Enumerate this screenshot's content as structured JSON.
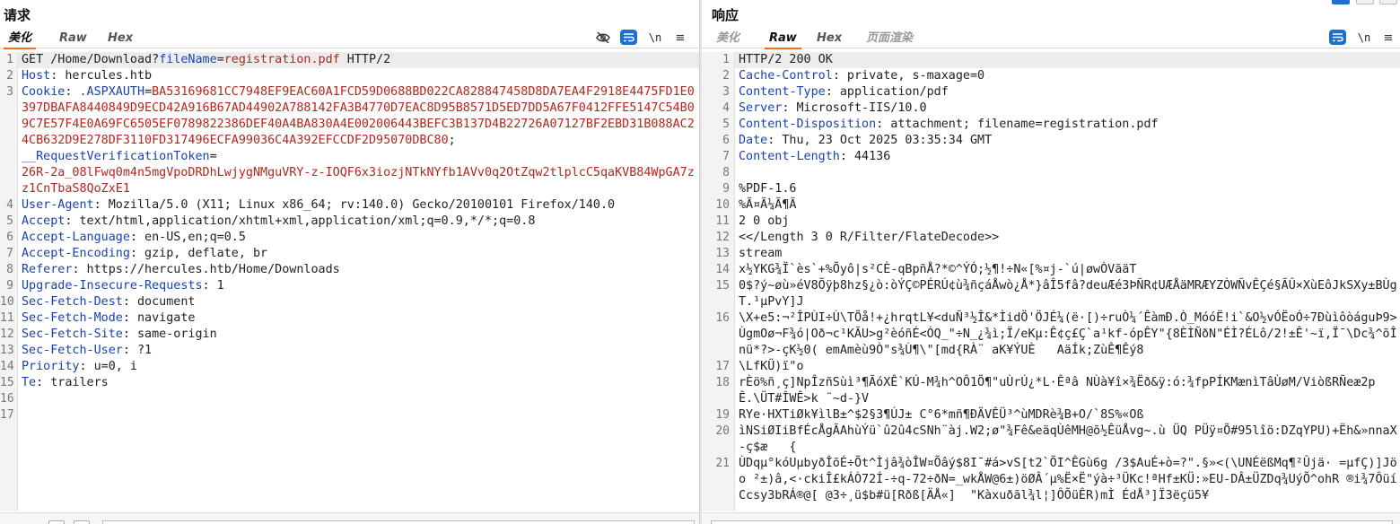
{
  "request": {
    "title": "请求",
    "tabs": [
      "美化",
      "Raw",
      "Hex"
    ],
    "active_tab": "美化",
    "toolbar": {
      "newline": "\\n",
      "menu": "≡"
    },
    "lines": [
      {
        "n": "1",
        "segs": [
          [
            "t",
            "GET /Home/Download?"
          ],
          [
            "k",
            "fileName"
          ],
          [
            "t",
            "="
          ],
          [
            "r",
            "registration.pdf"
          ],
          [
            "t",
            " HTTP/2"
          ]
        ]
      },
      {
        "n": "2",
        "segs": [
          [
            "k",
            "Host"
          ],
          [
            "t",
            ": hercules.htb"
          ]
        ]
      },
      {
        "n": "3",
        "segs": [
          [
            "k",
            "Cookie"
          ],
          [
            "t",
            ": "
          ],
          [
            "k",
            ".ASPXAUTH"
          ],
          [
            "t",
            "="
          ],
          [
            "r",
            "BA53169681CC7948EF9EAC60A1FCD59D0688BD022CA828847458D8DA7EA4F2918E4475FD1E0397DBAFA8440849D9ECD42A916B67AD44902A788142FA3B4770D7EAC8D95B8571D5ED7DD5A67F0412FFE5147C54B09C7E57F4E0A69FC6505EF0789822386DEF40A4BA830A4E002006443BEFC3B137D4B22726A07127BF2EBD31B088AC24CB632D9E278DF3110FD317496ECFA99036C4A392EFCCDF2D95070DBC80"
          ],
          [
            "t",
            ";"
          ]
        ]
      },
      {
        "n": "",
        "segs": [
          [
            "k",
            "__RequestVerificationToken"
          ],
          [
            "t",
            "="
          ]
        ]
      },
      {
        "n": "",
        "segs": [
          [
            "r",
            "26R-2a_08lFwq0m4n5mgVpoDRDhLwjygNMguVRY-z-IOQF6x3iozjNTkNYfb1AVv0q2OtZqw2tlplcC5qaKVB84WpGA7zz1CnTbaS8QoZxE1"
          ]
        ]
      },
      {
        "n": "4",
        "segs": [
          [
            "k",
            "User-Agent"
          ],
          [
            "t",
            ": Mozilla/5.0 (X11; Linux x86_64; rv:140.0) Gecko/20100101 Firefox/140.0"
          ]
        ]
      },
      {
        "n": "5",
        "segs": [
          [
            "k",
            "Accept"
          ],
          [
            "t",
            ": text/html,application/xhtml+xml,application/xml;q=0.9,*/*;q=0.8"
          ]
        ]
      },
      {
        "n": "6",
        "segs": [
          [
            "k",
            "Accept-Language"
          ],
          [
            "t",
            ": en-US,en;q=0.5"
          ]
        ]
      },
      {
        "n": "7",
        "segs": [
          [
            "k",
            "Accept-Encoding"
          ],
          [
            "t",
            ": gzip, deflate, br"
          ]
        ]
      },
      {
        "n": "8",
        "segs": [
          [
            "k",
            "Referer"
          ],
          [
            "t",
            ": https://hercules.htb/Home/Downloads"
          ]
        ]
      },
      {
        "n": "9",
        "segs": [
          [
            "k",
            "Upgrade-Insecure-Requests"
          ],
          [
            "t",
            ": 1"
          ]
        ]
      },
      {
        "n": "10",
        "segs": [
          [
            "k",
            "Sec-Fetch-Dest"
          ],
          [
            "t",
            ": document"
          ]
        ]
      },
      {
        "n": "11",
        "segs": [
          [
            "k",
            "Sec-Fetch-Mode"
          ],
          [
            "t",
            ": navigate"
          ]
        ]
      },
      {
        "n": "12",
        "segs": [
          [
            "k",
            "Sec-Fetch-Site"
          ],
          [
            "t",
            ": same-origin"
          ]
        ]
      },
      {
        "n": "13",
        "segs": [
          [
            "k",
            "Sec-Fetch-User"
          ],
          [
            "t",
            ": ?1"
          ]
        ]
      },
      {
        "n": "14",
        "segs": [
          [
            "k",
            "Priority"
          ],
          [
            "t",
            ": u=0, i"
          ]
        ]
      },
      {
        "n": "15",
        "segs": [
          [
            "k",
            "Te"
          ],
          [
            "t",
            ": trailers"
          ]
        ]
      },
      {
        "n": "16",
        "segs": []
      },
      {
        "n": "17",
        "segs": []
      }
    ]
  },
  "response": {
    "title": "响应",
    "tabs": [
      "美化",
      "Raw",
      "Hex",
      "页面渲染"
    ],
    "active_tab": "Raw",
    "toolbar": {
      "newline": "\\n",
      "menu": "≡"
    },
    "lines": [
      {
        "n": "1",
        "segs": [
          [
            "t",
            "HTTP/2 200 OK"
          ]
        ]
      },
      {
        "n": "2",
        "segs": [
          [
            "k",
            "Cache-Control"
          ],
          [
            "t",
            ": private, s-maxage=0"
          ]
        ]
      },
      {
        "n": "3",
        "segs": [
          [
            "k",
            "Content-Type"
          ],
          [
            "t",
            ": application/pdf"
          ]
        ]
      },
      {
        "n": "4",
        "segs": [
          [
            "k",
            "Server"
          ],
          [
            "t",
            ": Microsoft-IIS/10.0"
          ]
        ]
      },
      {
        "n": "5",
        "segs": [
          [
            "k",
            "Content-Disposition"
          ],
          [
            "t",
            ": attachment; filename=registration.pdf"
          ]
        ]
      },
      {
        "n": "6",
        "segs": [
          [
            "k",
            "Date"
          ],
          [
            "t",
            ": Thu, 23 Oct 2025 03:35:34 GMT"
          ]
        ]
      },
      {
        "n": "7",
        "segs": [
          [
            "k",
            "Content-Length"
          ],
          [
            "t",
            ": 44136"
          ]
        ]
      },
      {
        "n": "8",
        "segs": []
      },
      {
        "n": "9",
        "segs": [
          [
            "t",
            "%PDF-1.6"
          ]
        ]
      },
      {
        "n": "10",
        "segs": [
          [
            "t",
            "%Ã¤Ã¼Ã¶Ã"
          ]
        ]
      },
      {
        "n": "11",
        "segs": [
          [
            "t",
            "2 0 obj"
          ]
        ]
      },
      {
        "n": "12",
        "segs": [
          [
            "t",
            "<</Length 3 0 R/Filter/FlateDecode>>"
          ]
        ]
      },
      {
        "n": "13",
        "segs": [
          [
            "t",
            "stream"
          ]
        ]
      },
      {
        "n": "14",
        "segs": [
          [
            "t",
            "x½YKG¾Ï`ès`+%Õyô|s²CÈ-qBpñÅ?*©^ÝÓ;½¶!÷N«[%¤j-`ú|øwÒVãäT"
          ]
        ]
      },
      {
        "n": "15",
        "segs": [
          [
            "t",
            "0$?ý~øù»éV8Õÿþ8hz§¿ò:òÝÇ©PÉRÚ¢ù¾ñçáÅwò¿Å*}âÎ5fâ?deuÆé3ÞÑR¢UÆÅäMRÆYZÒWÑvÊÇé§ÃÛ×XùEôJkSXy±BÙgT.¹µPvY]J"
          ]
        ]
      },
      {
        "n": "16",
        "segs": [
          [
            "t",
            "\\X+e5:¬²ÎPÙI÷Ù\\TÕå!+¿hrqtL¥<duÑ³½Î&*ÌidÖ'ÖJÉ¼(ë·[)÷ruÒ¼´ÊàmÐ.Ò_MóóË!i`&O½vÓËoÓ÷7ÐùìôòáguÞ9>ÙgmOø¬F¾ó|Oð¬c¹KÃU>g²èóñÉ<ÓQ_\"÷N_¿¾ì;Ï/eKµ:Ê¢ç£Ç`a¹kf-ópÊY\"{8ÈÌÑðN\"ÉÌ?ÉLô/2!±Ê'~ï,Ï¯\\Dc¾^õÎnü*?>-çK½0( emAmèù9Ò\"s¾Ù¶\\\"[md{RÀ¨ aK¥ÝUÈ   AäÍk;ZùÊ¶Êý8"
          ]
        ]
      },
      {
        "n": "17",
        "segs": [
          [
            "t",
            "\\LfKÜ)ï\"o"
          ]
        ]
      },
      {
        "n": "18",
        "segs": [
          [
            "t",
            "rÈö%ñ¸ç]NpÎzñSùì³¶ÃóXÊ`KÚ-M¾h^OÔ1Õ¶\"uÙrÚ¿*L·Êªâ NÙà¥î×¾Ëð&ÿ:ó:¾fpPÍKMænìTâÙøM/ViòßRÑeæ2pÊ.\\ÜT#ÎWÊ>k ¨~d-}V"
          ]
        ]
      },
      {
        "n": "19",
        "segs": [
          [
            "t",
            "RYe·HXTiØk¥ìlB±^$2§3¶ÚJ± C°6*mñ¶ÐÄVÊÜ³^ùMDRè¾B+O/`8S%«Oß"
          ]
        ]
      },
      {
        "n": "20",
        "segs": [
          [
            "t",
            "ìNSiØIiBfÉcÅgÃAhùÝü`û2û4cSNh¨àj.W2;ø\"¾Fê&eäqÙêMH@õ½ÊüÅvg~.ù ÜQ PÜÿ¤Õ#95lîö:DZqYPU)+Ëh&»nnaX-ç$æ   {"
          ]
        ]
      },
      {
        "n": "21",
        "segs": [
          [
            "t",
            "ÙDqµ°kóUµbyðÎõÉ÷Õt^Ìjâ¾òÎW¤Õâý$8I¯#á>vS[t2`ÕI^ÊGù6g /3$AuÉ+ò=?\".§»<(\\UNÉëßMq¶²Ûjä· =µfÇ)]Jöo ²±)â,<·ckiÎ£kÁÒ72Í-÷q-72÷ðN=_wkÅW@6±)öØÂ´µ%Ë×Ë\"ýà÷³ÜKc!ªHf±KÜ:»EU-DÂ±ÜZDq¾UýÕ^ohR ®i¾7ÔüíCcsy3bRÁ®@[ @3÷¸ü$b#ü[Rðß[ÄÅ«]  \"Kàxuðãl¾l¦]ÔÕüÊR)mÌ ÉdÅ³]Ï3ëçü5¥"
          ]
        ]
      }
    ]
  }
}
